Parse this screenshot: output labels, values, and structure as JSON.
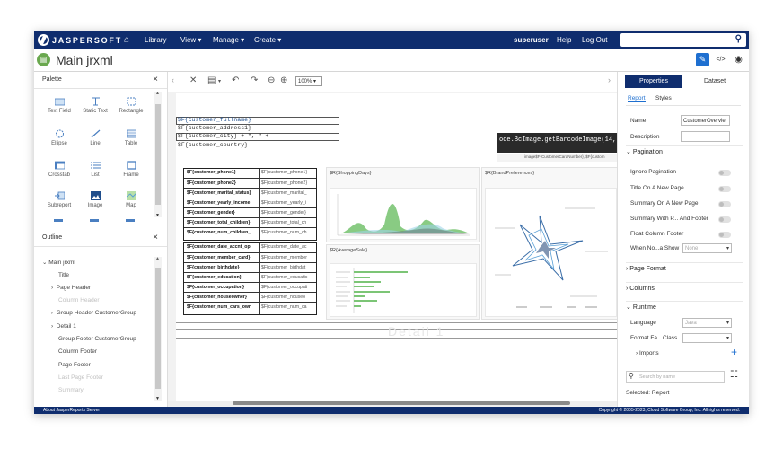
{
  "topbar": {
    "logo_text": "JASPERSOFT",
    "nav": [
      "Library",
      "View ▾",
      "Manage ▾",
      "Create ▾"
    ],
    "user": "superuser",
    "help": "Help",
    "logout": "Log Out",
    "search_placeholder": ""
  },
  "title": "Main jrxml",
  "palette": {
    "title": "Palette",
    "items": [
      "Text Field",
      "Static Text",
      "Rectangle",
      "Ellipse",
      "Line",
      "Table",
      "Crosstab",
      "List",
      "Frame",
      "Subreport",
      "Image",
      "Map"
    ]
  },
  "outline": {
    "title": "Outline",
    "items": [
      {
        "label": "Main jrxml",
        "prefix": "⌄"
      },
      {
        "label": "Title",
        "prefix": ""
      },
      {
        "label": "Page Header",
        "prefix": "›"
      },
      {
        "label": "Column Header",
        "prefix": ""
      },
      {
        "label": "Group Header CustomerGroup",
        "prefix": "›"
      },
      {
        "label": "Detail 1",
        "prefix": "›"
      },
      {
        "label": "Group Footer CustomerGroup",
        "prefix": ""
      },
      {
        "label": "Column Footer",
        "prefix": ""
      },
      {
        "label": "Page Footer",
        "prefix": ""
      },
      {
        "label": "Last Page Footer",
        "prefix": ""
      },
      {
        "label": "Summary",
        "prefix": ""
      }
    ]
  },
  "editor": {
    "zoom": "100%",
    "fields": [
      "$F{customer_fullname}",
      "$F{customer_address1}",
      "$F{customer_city} + \", \" +",
      "$F{customer_country}"
    ],
    "barcode": "ode.BcImage.getBarcodeImage(14,",
    "barcode_sub": "image$F{CustomerCardNumber}, $F{custom",
    "table_rows": [
      [
        "$F{customer_phone1}",
        "$F{customer_phone1}"
      ],
      [
        "$F{customer_phone2}",
        "$F{customer_phone2}"
      ],
      [
        "$F{customer_marital_status}",
        "$F{customer_marital_"
      ],
      [
        "$F{customer_yearly_income",
        "$F{customer_yearly_i"
      ],
      [
        "$F{customer_gender}",
        "$F{customer_gender}"
      ],
      [
        "$F{customer_total_children}",
        "$F{customer_total_ch"
      ],
      [
        "$F{customer_num_children_",
        "$F{customer_num_ch"
      ],
      [
        "$F{customer_date_accnt_op",
        "$F{customer_date_ac"
      ],
      [
        "$F{customer_member_card}",
        "$F{customer_member"
      ],
      [
        "$F{customer_birthdate}",
        "$F{customer_birthdat"
      ],
      [
        "$F{customer_education}",
        "$F{customer_educatic"
      ],
      [
        "$F{customer_occupation}",
        "$F{customer_occupati"
      ],
      [
        "$F{customer_houseowner}",
        "$F{customer_houseo"
      ],
      [
        "$F{customer_num_cars_own",
        "$F{customer_num_ca"
      ]
    ],
    "chart_labels": [
      "$R{ShoppingDays}",
      "$R{BrandPreferences}",
      "$R{AverageSale}"
    ],
    "band_watermark": "Detail 1"
  },
  "properties": {
    "tab_properties": "Properties",
    "tab_dataset": "Dataset",
    "sub_report": "Report",
    "sub_styles": "Styles",
    "name_label": "Name",
    "name_value": "CustomerOvervie",
    "description_label": "Description",
    "pagination_section": "Pagination",
    "toggles": [
      "Ignore Pagination",
      "Title On A New Page",
      "Summary On A New Page",
      "Summary With P... And Footer",
      "Float Column Footer"
    ],
    "when_no_label": "When No...a Show",
    "when_no_value": "None",
    "page_format": "Page Format",
    "columns": "Columns",
    "runtime": "Runtime",
    "language_label": "Language",
    "language_value": "Java",
    "format_label": "Format Fa...",
    "class_label": "Class",
    "imports": "Imports",
    "search_placeholder": "Search by name",
    "selected": "Selected: Report"
  },
  "status": {
    "left": "About JasperReports Server",
    "right": "Copyright © 2005-2023, Cloud Software Group, Inc. All rights reserved."
  },
  "colors": {
    "brand": "#0f2d6e",
    "accent_button": "#1e6fd0",
    "chart_green": "#7cc576"
  }
}
